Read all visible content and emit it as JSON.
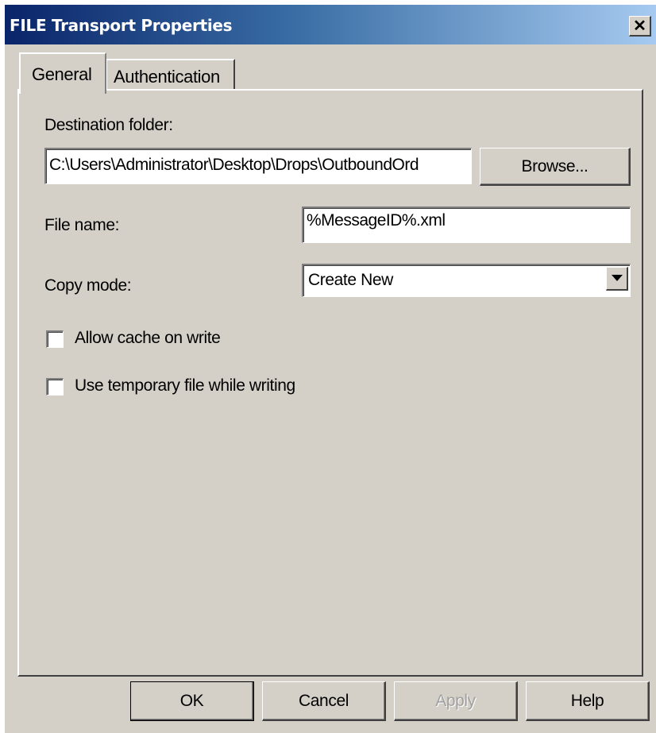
{
  "window": {
    "title": "FILE Transport Properties",
    "close_icon": "close-icon",
    "close_glyph": "✕"
  },
  "tabs": [
    {
      "label": "General",
      "selected": true
    },
    {
      "label": "Authentication",
      "selected": false
    }
  ],
  "general": {
    "destination_folder_label": "Destination folder:",
    "destination_folder_value": "C:\\Users\\Administrator\\Desktop\\Drops\\OutboundOrd",
    "browse_label": "Browse...",
    "file_name_label": "File name:",
    "file_name_value": "%MessageID%.xml",
    "copy_mode_label": "Copy mode:",
    "copy_mode_value": "Create New",
    "allow_cache_label": "Allow cache on write",
    "allow_cache_checked": false,
    "use_temp_label": "Use temporary file while writing",
    "use_temp_checked": false
  },
  "buttons": {
    "ok": "OK",
    "cancel": "Cancel",
    "apply": "Apply",
    "help": "Help"
  },
  "colors": {
    "dialog_face": "#d4d0c8",
    "title_start": "#0a246a",
    "title_end": "#a6caf0"
  }
}
